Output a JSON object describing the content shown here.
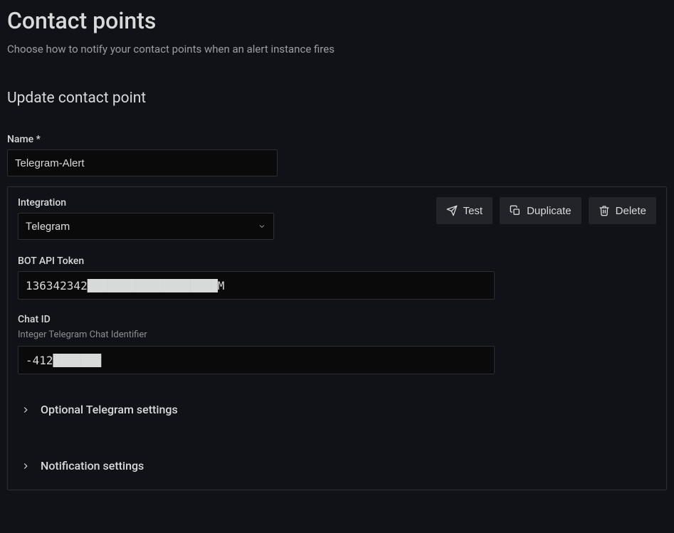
{
  "page": {
    "title": "Contact points",
    "subtitle": "Choose how to notify your contact points when an alert instance fires",
    "section_title": "Update contact point"
  },
  "name_field": {
    "label": "Name *",
    "value": "Telegram-Alert"
  },
  "integration": {
    "label": "Integration",
    "selected": "Telegram"
  },
  "buttons": {
    "test": "Test",
    "duplicate": "Duplicate",
    "delete": "Delete"
  },
  "bot_token": {
    "label": "BOT API Token",
    "value": "136342342███████████████████M"
  },
  "chat_id": {
    "label": "Chat ID",
    "help": "Integer Telegram Chat Identifier",
    "value": "-412███████"
  },
  "expanders": {
    "optional": "Optional Telegram settings",
    "notification": "Notification settings"
  }
}
